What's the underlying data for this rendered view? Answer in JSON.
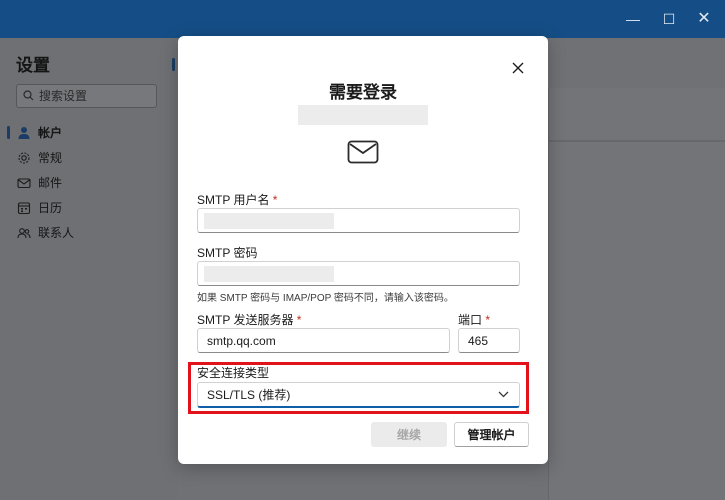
{
  "window": {
    "controls": {
      "minimize": "—",
      "maximize": "☐",
      "close": "✕"
    }
  },
  "sidebar": {
    "title": "设置",
    "search": {
      "placeholder": "搜索设置",
      "value": ""
    },
    "items": [
      {
        "label": "帐户",
        "icon": "person-icon",
        "active": true
      },
      {
        "label": "常规",
        "icon": "gear-icon",
        "active": false
      },
      {
        "label": "邮件",
        "icon": "mail-icon",
        "active": false
      },
      {
        "label": "日历",
        "icon": "calendar-icon",
        "active": false
      },
      {
        "label": "联系人",
        "icon": "contacts-icon",
        "active": false
      }
    ]
  },
  "dialog": {
    "title": "需要登录",
    "icon": "envelope-icon",
    "username": {
      "label": "SMTP 用户名",
      "required_mark": "*",
      "value": ""
    },
    "password": {
      "label": "SMTP 密码",
      "value": ""
    },
    "hint": "如果 SMTP 密码与 IMAP/POP 密码不同，请输入该密码。",
    "server": {
      "label": "SMTP 发送服务器",
      "required_mark": "*",
      "value": "smtp.qq.com"
    },
    "port": {
      "label": "端口",
      "required_mark": "*",
      "value": "465"
    },
    "security": {
      "label": "安全连接类型",
      "selected": "SSL/TLS (推荐)"
    },
    "buttons": {
      "continue": "继续",
      "manage": "管理帐户"
    }
  },
  "colors": {
    "titlebar": "#154e86",
    "highlight": "#e2121a",
    "accent": "#0f5fa8",
    "required": "#c42b1c"
  }
}
